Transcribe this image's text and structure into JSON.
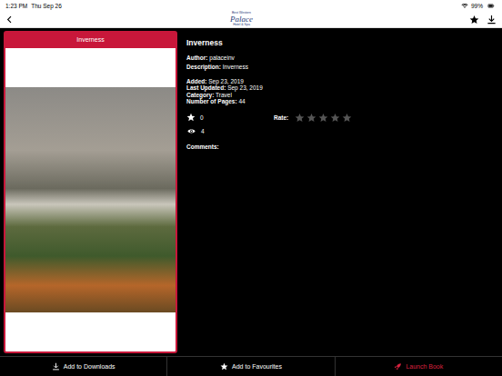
{
  "status_bar": {
    "time": "1:23 PM",
    "date": "Thu Sep 26",
    "battery": "99%"
  },
  "nav": {
    "logo": {
      "line1": "Best Western",
      "line2": "Palace",
      "line3": "Hotel & Spa"
    }
  },
  "book": {
    "card_title": "Inverness",
    "title": "Inverness",
    "fields": [
      {
        "label": "Author:",
        "value": "palaceinv"
      },
      {
        "label": "Description:",
        "value": "Inverness"
      }
    ],
    "meta": [
      {
        "label": "Added:",
        "value": "Sep 23, 2019"
      },
      {
        "label": "Last Updated:",
        "value": "Sep 23, 2019"
      },
      {
        "label": "Category:",
        "value": "Travel"
      },
      {
        "label": "Number of Pages:",
        "value": "44"
      }
    ],
    "favourites": "0",
    "views": "4",
    "rate": {
      "label": "Rate:",
      "stars": 0
    },
    "comments_label": "Comments:"
  },
  "buttons": [
    {
      "label": "Add to Downloads",
      "kind": "download"
    },
    {
      "label": "Add to Favourites",
      "kind": "favourite"
    },
    {
      "label": "Launch Book",
      "kind": "launch"
    }
  ]
}
